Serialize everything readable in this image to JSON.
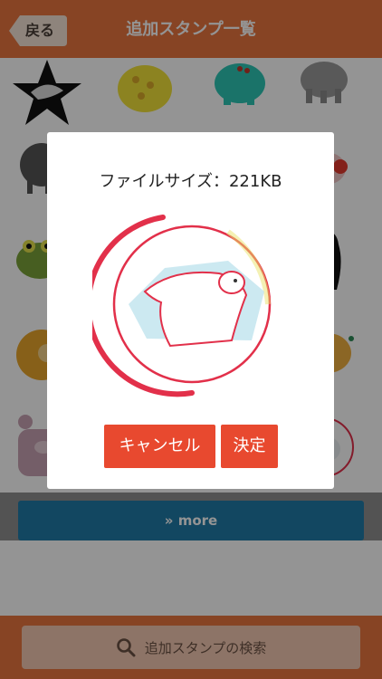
{
  "header": {
    "back_label": "戻る",
    "title": "追加スタンプ一覧"
  },
  "stickers": [
    {
      "icon": "dragon-star-sticker",
      "color": "#111111"
    },
    {
      "icon": "yellow-spotted-blob-sticker",
      "color": "#f1e23a"
    },
    {
      "icon": "teal-elephant-sticker",
      "color": "#2ec6b5"
    },
    {
      "icon": "gray-elephant-sticker",
      "color": "#9a9a9a"
    },
    {
      "icon": "sketch-elephant-sticker",
      "color": "#555555"
    },
    {
      "icon": "bird-line-sticker",
      "color": "#888888"
    },
    {
      "icon": "outline-sticker",
      "color": "#bbbbbb"
    },
    {
      "icon": "red-bird-sticker",
      "color": "#e23a2e"
    },
    {
      "icon": "frog-sticker",
      "color": "#7aa33a"
    },
    {
      "icon": "bird-line-sticker-2",
      "color": "#777777"
    },
    {
      "icon": "outline-sticker-2",
      "color": "#cccccc"
    },
    {
      "icon": "black-creature-sticker",
      "color": "#111111"
    },
    {
      "icon": "orange-fluffy-sticker",
      "color": "#e8a62c"
    },
    {
      "icon": "brown-pattern-sticker",
      "color": "#a07850"
    },
    {
      "icon": "outline-sticker-3",
      "color": "#dddddd"
    },
    {
      "icon": "orange-chick-sticker",
      "color": "#f0a030"
    },
    {
      "icon": "pink-bear-sticker",
      "color": "#c9a3b3"
    },
    {
      "icon": "outline-sticker-4",
      "color": "#d8c0c8"
    },
    {
      "icon": "outline-sticker-5",
      "color": "#e6d2d8"
    },
    {
      "icon": "polar-bear-mini-sticker",
      "color": "#e2304a"
    }
  ],
  "more": {
    "label": "» more"
  },
  "footer": {
    "search_label": "追加スタンプの検索",
    "icon": "search-icon"
  },
  "dialog": {
    "size_text": "ファイルサイズ：221KB",
    "preview_icon": "polar-bear-sticker",
    "cancel_label": "キャンセル",
    "ok_label": "決定"
  },
  "colors": {
    "header": "#e8753f",
    "more_button": "#1f7aa7",
    "dialog_button": "#e8492f",
    "search_button": "#f3c9b1"
  }
}
